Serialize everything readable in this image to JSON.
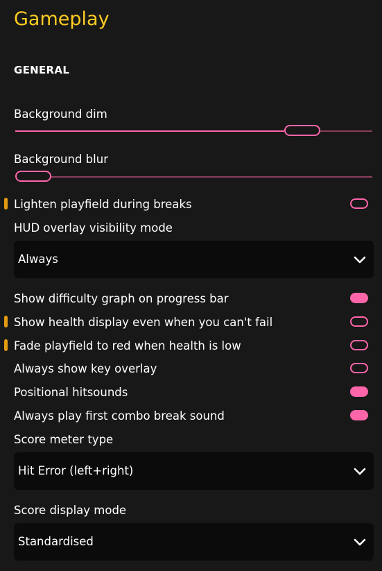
{
  "page": {
    "title": "Gameplay"
  },
  "section": {
    "title": "GENERAL"
  },
  "settings": {
    "background_dim": {
      "label": "Background dim",
      "value_fraction": 0.8
    },
    "background_blur": {
      "label": "Background blur",
      "value_fraction": 0.0
    },
    "lighten_playfield": {
      "label": "Lighten playfield during breaks",
      "enabled": false,
      "modified": true
    },
    "hud_visibility": {
      "label": "HUD overlay visibility mode",
      "value": "Always"
    },
    "difficulty_graph": {
      "label": "Show difficulty graph on progress bar",
      "enabled": true,
      "modified": false
    },
    "health_display": {
      "label": "Show health display even when you can't fail",
      "enabled": false,
      "modified": true
    },
    "fade_red": {
      "label": "Fade playfield to red when health is low",
      "enabled": false,
      "modified": true
    },
    "key_overlay": {
      "label": "Always show key overlay",
      "enabled": false,
      "modified": false
    },
    "positional_hitsounds": {
      "label": "Positional hitsounds",
      "enabled": true,
      "modified": false
    },
    "combo_break_sound": {
      "label": "Always play first combo break sound",
      "enabled": true,
      "modified": false
    },
    "score_meter_type": {
      "label": "Score meter type",
      "value": "Hit Error (left+right)"
    },
    "score_display_mode": {
      "label": "Score display mode",
      "value": "Standardised"
    }
  },
  "colors": {
    "accent_pink": "#ff66aa",
    "title_yellow": "#ffcc22",
    "modified_marker": "#e39b11",
    "background": "#181818",
    "dropdown_bg": "#0b0b0b"
  },
  "icons": {
    "dropdown": "chevron-down-icon",
    "modified": "modified-indicator"
  }
}
